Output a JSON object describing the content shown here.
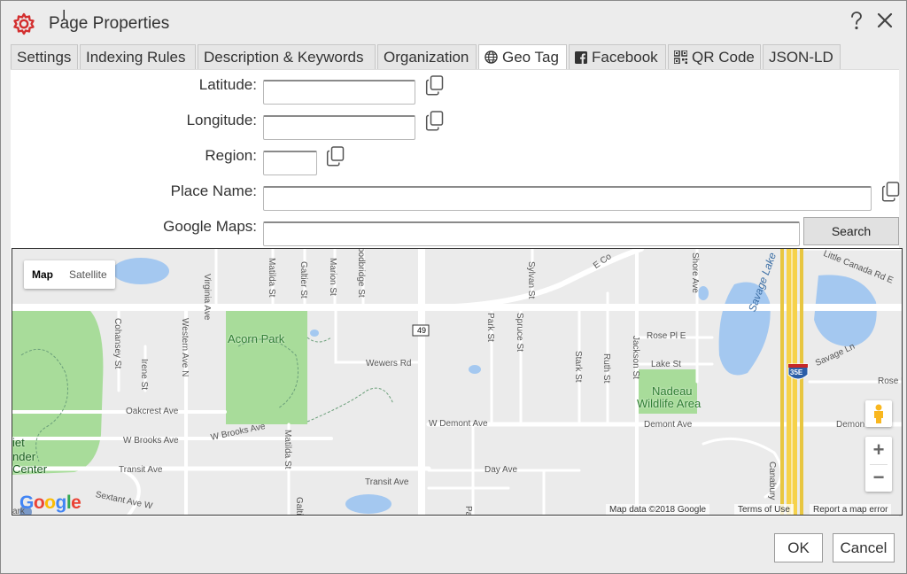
{
  "dialog": {
    "title": "Page Properties",
    "accent_color": "#d32f2f",
    "help_icon": "help-question-icon",
    "close_icon": "close-icon"
  },
  "tabs": [
    {
      "label": "Settings",
      "active": false
    },
    {
      "label": "Indexing Rules",
      "active": false
    },
    {
      "label": "Description & Keywords",
      "active": false
    },
    {
      "label": "Organization",
      "active": false
    },
    {
      "label": "Geo Tag",
      "active": true,
      "icon": "globe-icon"
    },
    {
      "label": "Facebook",
      "active": false,
      "icon": "facebook-icon"
    },
    {
      "label": "QR Code",
      "active": false,
      "icon": "qr-code-icon"
    },
    {
      "label": "JSON-LD",
      "active": false
    }
  ],
  "form": {
    "latitude": {
      "label": "Latitude:",
      "value": ""
    },
    "longitude": {
      "label": "Longitude:",
      "value": ""
    },
    "region": {
      "label": "Region:",
      "value": ""
    },
    "place_name": {
      "label": "Place Name:",
      "value": ""
    },
    "google_maps": {
      "label": "Google Maps:",
      "value": ""
    },
    "search_label": "Search"
  },
  "map": {
    "type_map": "Map",
    "type_satellite": "Satellite",
    "zoom_in": "+",
    "zoom_out": "−",
    "logo": "Google",
    "attribution": "Map data ©2018 Google",
    "terms": "Terms of Use",
    "report": "Report a map error",
    "route_shield": "49",
    "interstate_shield": "35E",
    "parks": [
      "Acorn Park",
      "Nadeau",
      "Wildlife Area",
      "iet",
      "nder",
      "Center"
    ],
    "lakes": [
      "Savage Lake"
    ],
    "streets": [
      "Virginia Ave",
      "Matilda St",
      "Galtier St",
      "Marion St",
      "oodbridge St",
      "Sylvan St",
      "E Co",
      "Shore Ave",
      "Little Canada Rd E",
      "Cohansey St",
      "Western Ave N",
      "Irene St",
      "Park St",
      "Spruce St",
      "Wewers Rd",
      "Rose Pl E",
      "Stark St",
      "Ruth St",
      "Jackson St",
      "Lake St",
      "Savage Ln",
      "Rose L",
      "Oakcrest Ave",
      "W Demont Ave",
      "Demont Ave",
      "Demon",
      "W Brooks Ave",
      "W Brooks Ave",
      "Matilda St",
      "Transit Ave",
      "Day Ave",
      "Transit Ave",
      "Sextant Ave W",
      "Canabury",
      "Galti",
      "Pa",
      "ark"
    ],
    "colors": {
      "park": "#a8dc9a",
      "water": "#a4c8f0",
      "road": "#ffffff",
      "highway": "#f6d24a",
      "background": "#ebebeb"
    }
  },
  "footer": {
    "ok_label": "OK",
    "cancel_label": "Cancel"
  }
}
